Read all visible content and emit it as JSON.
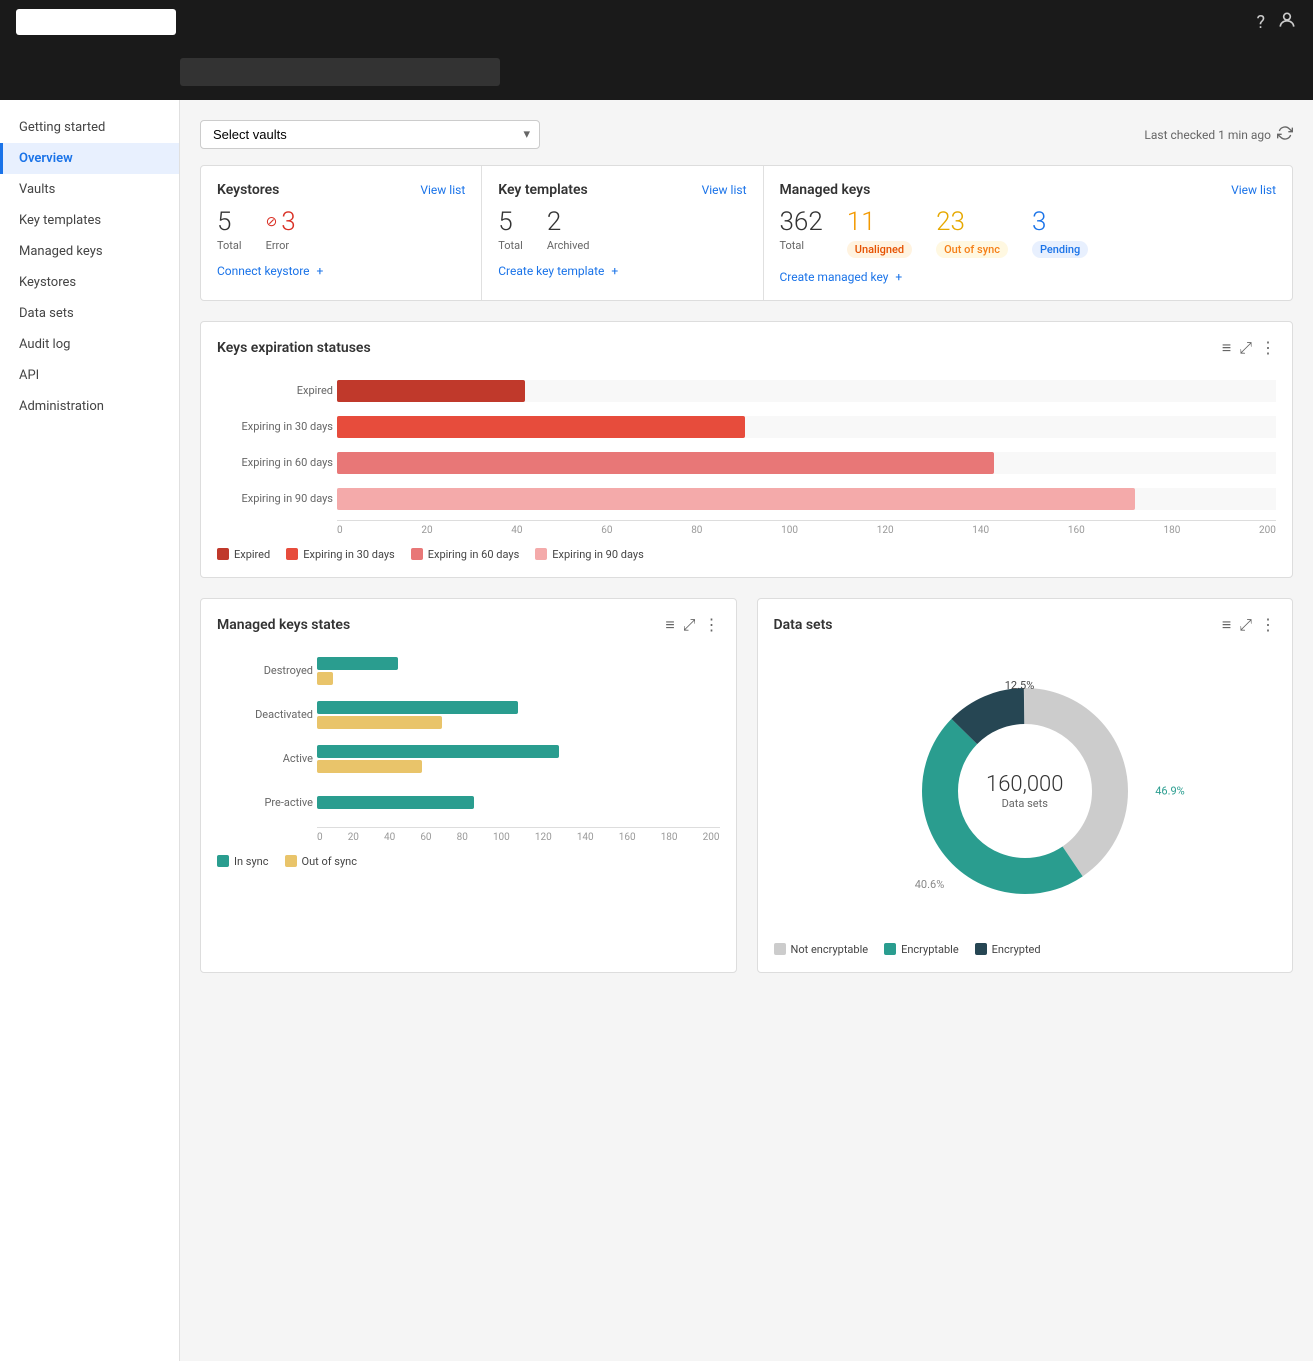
{
  "topnav": {
    "search_placeholder": "",
    "help_icon": "?",
    "user_icon": "👤"
  },
  "sidebar": {
    "items": [
      {
        "label": "Getting started",
        "active": false
      },
      {
        "label": "Overview",
        "active": true
      },
      {
        "label": "Vaults",
        "active": false
      },
      {
        "label": "Key templates",
        "active": false
      },
      {
        "label": "Managed keys",
        "active": false
      },
      {
        "label": "Keystores",
        "active": false
      },
      {
        "label": "Data sets",
        "active": false
      },
      {
        "label": "Audit log",
        "active": false
      },
      {
        "label": "API",
        "active": false
      },
      {
        "label": "Administration",
        "active": false
      }
    ]
  },
  "vault_selector": {
    "placeholder": "Select vaults",
    "last_checked": "Last checked 1 min ago"
  },
  "keystores_card": {
    "title": "Keystores",
    "view_link": "View list",
    "total": "5",
    "total_label": "Total",
    "error_count": "3",
    "error_label": "Error",
    "action": "Connect keystore",
    "action_plus": "+"
  },
  "key_templates_card": {
    "title": "Key templates",
    "view_link": "View list",
    "total": "5",
    "total_label": "Total",
    "archived": "2",
    "archived_label": "Archived",
    "action": "Create key template",
    "action_plus": "+"
  },
  "managed_keys_card": {
    "title": "Managed keys",
    "view_link": "View list",
    "total": "362",
    "total_label": "Total",
    "unaligned": "11",
    "unaligned_label": "Unaligned",
    "out_of_sync": "23",
    "out_of_sync_label": "Out of sync",
    "pending": "3",
    "pending_label": "Pending",
    "action": "Create managed key",
    "action_plus": "+"
  },
  "expiration_chart": {
    "title": "Keys expiration statuses",
    "bars": [
      {
        "label": "Expired",
        "value": 40,
        "max": 200,
        "color": "#c0392b"
      },
      {
        "label": "Expiring in 30 days",
        "value": 87,
        "max": 200,
        "color": "#e74c3c"
      },
      {
        "label": "Expiring in 60 days",
        "value": 140,
        "max": 200,
        "color": "#e87777"
      },
      {
        "label": "Expiring in 90 days",
        "value": 170,
        "max": 200,
        "color": "#f4aaaa"
      }
    ],
    "x_ticks": [
      "0",
      "20",
      "40",
      "60",
      "80",
      "100",
      "120",
      "140",
      "160",
      "180",
      "200"
    ],
    "legend": [
      {
        "label": "Expired",
        "color": "#c0392b"
      },
      {
        "label": "Expiring in 30 days",
        "color": "#e74c3c"
      },
      {
        "label": "Expiring in 60 days",
        "color": "#e87777"
      },
      {
        "label": "Expiring in 90 days",
        "color": "#f4aaaa"
      }
    ]
  },
  "managed_keys_states_chart": {
    "title": "Managed keys states",
    "rows": [
      {
        "label": "Destroyed",
        "in_sync": 40,
        "out_of_sync": 8,
        "max": 200
      },
      {
        "label": "Deactivated",
        "in_sync": 100,
        "out_of_sync": 62,
        "max": 200
      },
      {
        "label": "Active",
        "in_sync": 120,
        "out_of_sync": 52,
        "max": 200
      },
      {
        "label": "Pre-active",
        "in_sync": 78,
        "out_of_sync": 0,
        "max": 200
      }
    ],
    "x_ticks": [
      "0",
      "20",
      "40",
      "60",
      "80",
      "100",
      "120",
      "140",
      "160",
      "180",
      "200"
    ],
    "legend": [
      {
        "label": "In sync",
        "color": "#2a9d8f"
      },
      {
        "label": "Out of sync",
        "color": "#e9c46a"
      }
    ],
    "in_sync_color": "#2a9d8f",
    "out_of_sync_color": "#e9c46a"
  },
  "datasets_chart": {
    "title": "Data sets",
    "total": "160,000",
    "total_label": "Data sets",
    "segments": [
      {
        "label": "Not encryptable",
        "value": 40.6,
        "color": "#bbb"
      },
      {
        "label": "Encryptable",
        "value": 46.9,
        "color": "#2a9d8f"
      },
      {
        "label": "Encrypted",
        "value": 12.5,
        "color": "#264653"
      }
    ],
    "donut_labels": [
      {
        "position": "top",
        "value": "12.5%",
        "color": "#264653"
      },
      {
        "position": "right",
        "value": "46.9%",
        "color": "#2a9d8f"
      },
      {
        "position": "bottom",
        "value": "40.6%",
        "color": "#888"
      }
    ],
    "legend": [
      {
        "label": "Not encryptable",
        "color": "#ccc"
      },
      {
        "label": "Encryptable",
        "color": "#2a9d8f"
      },
      {
        "label": "Encrypted",
        "color": "#264653"
      }
    ]
  }
}
